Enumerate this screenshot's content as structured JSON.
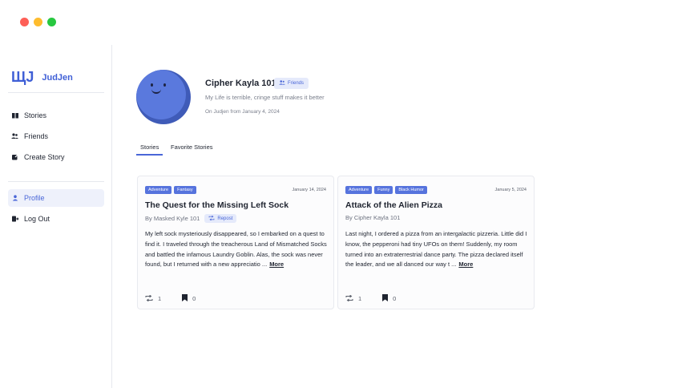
{
  "window": {
    "buttons": [
      "close",
      "minimize",
      "maximize"
    ]
  },
  "brand": {
    "mark": "ЩJ",
    "name": "JudJen"
  },
  "sidebar": {
    "items": [
      {
        "label": "Stories",
        "icon": "book-icon"
      },
      {
        "label": "Friends",
        "icon": "people-icon"
      },
      {
        "label": "Create Story",
        "icon": "create-icon"
      }
    ],
    "bottom": [
      {
        "label": "Profile",
        "icon": "person-icon",
        "active": true
      },
      {
        "label": "Log Out",
        "icon": "logout-icon"
      }
    ]
  },
  "profile": {
    "name": "Cipher Kayla 101",
    "friend_badge": "Friends",
    "bio": "My Life is terrible, cringe stuff makes it better",
    "joined": "On Judjen from January 4, 2024"
  },
  "tabs": [
    {
      "label": "Stories",
      "active": true
    },
    {
      "label": "Favorite Stories",
      "active": false
    }
  ],
  "stories": [
    {
      "tags": [
        "Adventure",
        "Fantasy"
      ],
      "date": "January 14, 2024",
      "title": "The Quest for the Missing Left Sock",
      "author": "By Masked Kyle 101",
      "repost_label": "Repost",
      "body": "My left sock mysteriously disappeared, so I embarked on a quest to find it. I traveled through the treacherous Land of Mismatched Socks and battled the infamous Laundry Goblin. Alas, the sock was never found, but I returned with a new appreciatio ...",
      "more_label": "More",
      "reposts": "1",
      "bookmarks": "0"
    },
    {
      "tags": [
        "Adventure",
        "Funny",
        "Black Humor"
      ],
      "date": "January 5, 2024",
      "title": "Attack of the Alien Pizza",
      "author": "By Cipher Kayla 101",
      "body": "Last night, I ordered a pizza from an intergalactic pizzeria. Little did I know, the pepperoni had tiny UFOs on them! Suddenly, my room turned into an extraterrestrial dance party. The pizza declared itself the leader, and we all danced our way t ...",
      "more_label": "More",
      "reposts": "1",
      "bookmarks": "0"
    }
  ],
  "colors": {
    "accent": "#4a67d8",
    "tag": "#5673dd",
    "avatar": "#5a79dd"
  }
}
